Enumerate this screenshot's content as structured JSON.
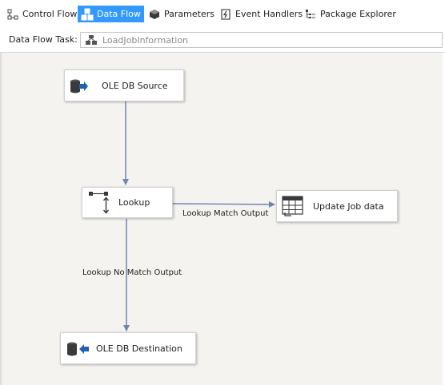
{
  "tabs": [
    {
      "label": "Control Flow",
      "icon": "control-flow-icon",
      "active": false
    },
    {
      "label": "Data Flow",
      "icon": "data-flow-icon",
      "active": true
    },
    {
      "label": "Parameters",
      "icon": "parameters-icon",
      "active": false
    },
    {
      "label": "Event Handlers",
      "icon": "event-handlers-icon",
      "active": false
    },
    {
      "label": "Package Explorer",
      "icon": "package-explorer-icon",
      "active": false
    }
  ],
  "task": {
    "label": "Data Flow Task:",
    "value": "LoadJobInformation"
  },
  "nodes": {
    "source": {
      "label": "OLE DB Source",
      "icon": "ole-db-source-icon"
    },
    "lookup": {
      "label": "Lookup",
      "icon": "lookup-icon"
    },
    "update": {
      "label": "Update Job data",
      "icon": "ole-db-command-icon"
    },
    "destination": {
      "label": "OLE DB Destination",
      "icon": "ole-db-destination-icon"
    }
  },
  "paths": {
    "match": "Lookup Match Output",
    "no_match": "Lookup No Match Output"
  },
  "colors": {
    "active_tab": "#3399ff",
    "canvas": "#f5f3ef",
    "connector": "#6f86ad",
    "db_icon": "#3a3a3a",
    "arrow_icon": "#1f5fb8"
  }
}
